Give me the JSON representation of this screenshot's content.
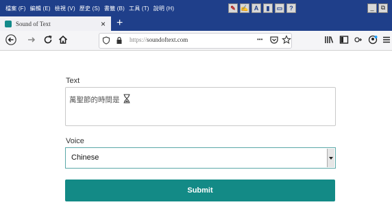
{
  "menubar": {
    "items": [
      "檔案 (F)",
      "編輯 (E)",
      "檢視 (V)",
      "歷史 (S)",
      "書籤 (B)",
      "工具 (T)",
      "說明 (H)"
    ]
  },
  "tab": {
    "title": "Sound of Text",
    "favicon_color": "#138a8a",
    "close": "×",
    "new_tab": "+"
  },
  "navbar": {
    "url_protocol": "https://",
    "url_host": "soundoftext.com",
    "more_actions": "•••"
  },
  "form": {
    "text_label": "Text",
    "text_value": "萬聖節的時間是",
    "voice_label": "Voice",
    "voice_value": "Chinese",
    "submit_label": "Submit"
  },
  "colors": {
    "titlebar": "#1f3f8a",
    "accent": "#138a86"
  }
}
